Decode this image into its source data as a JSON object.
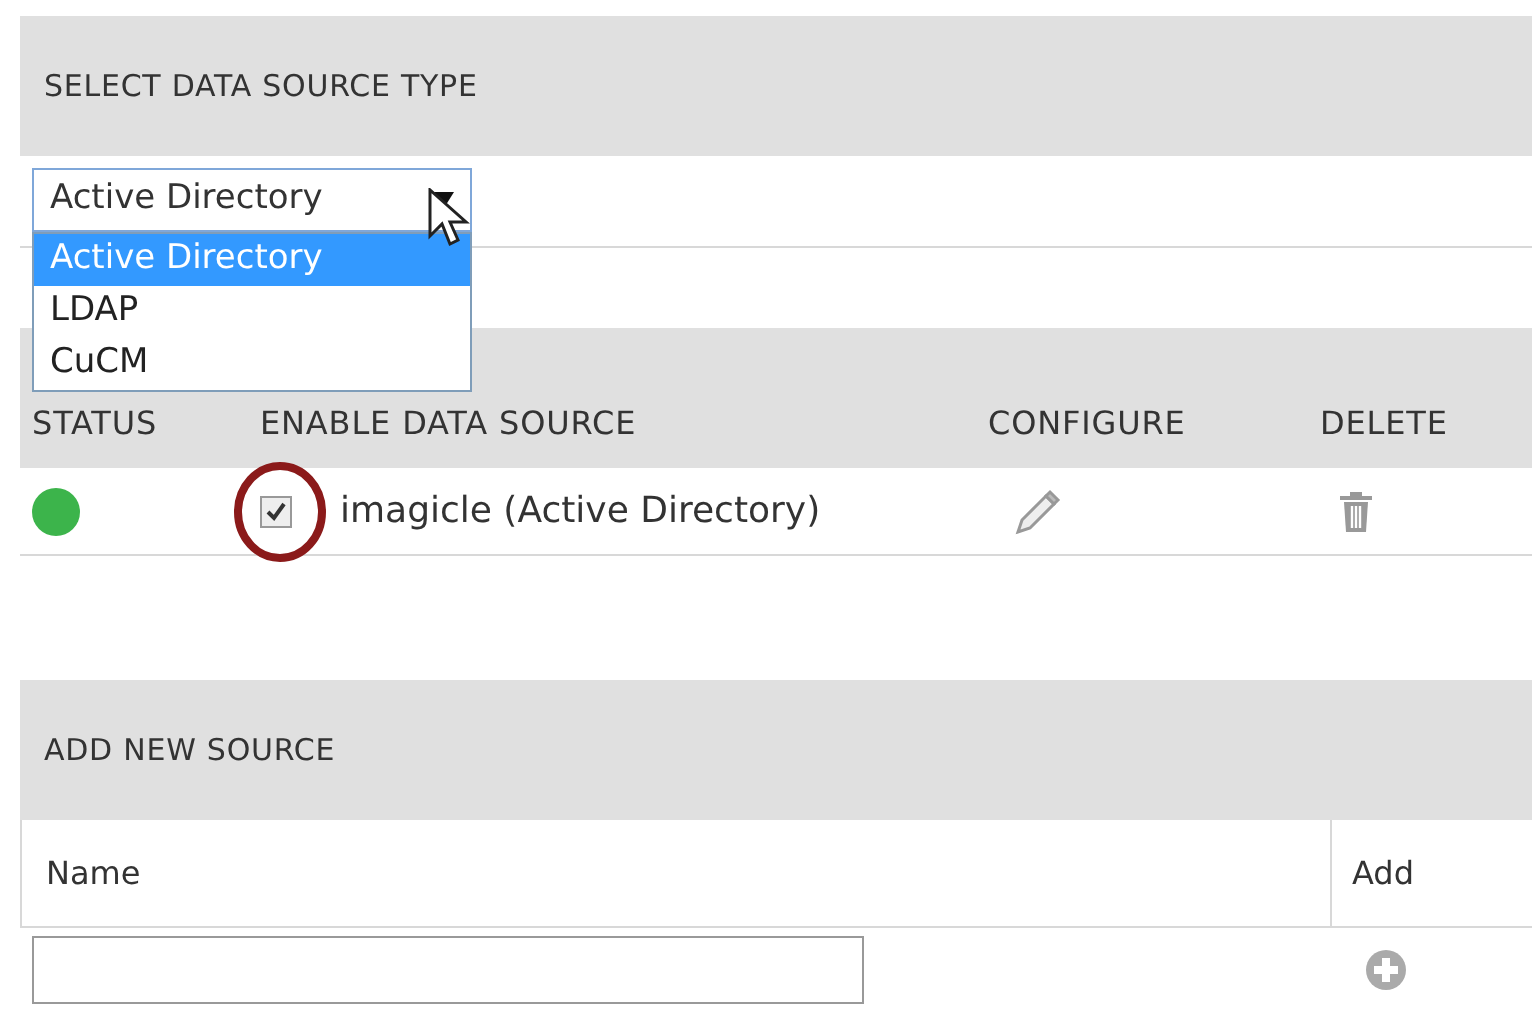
{
  "select_section": {
    "title": "SELECT DATA SOURCE TYPE",
    "select": {
      "value": "Active Directory",
      "expanded": true,
      "options": [
        {
          "label": "Active Directory",
          "selected": true
        },
        {
          "label": "LDAP",
          "selected": false
        },
        {
          "label": "CuCM",
          "selected": false
        }
      ]
    }
  },
  "sources_table": {
    "columns": [
      "STATUS",
      "ENABLE DATA SOURCE",
      "CONFIGURE",
      "DELETE"
    ],
    "rows": [
      {
        "color": "#3cb44b",
        "enabled": true,
        "name": "imagicle (Active Directory)"
      }
    ]
  },
  "add_section": {
    "title": "ADD NEW SOURCE",
    "columns": [
      "Name",
      "Add"
    ]
  }
}
